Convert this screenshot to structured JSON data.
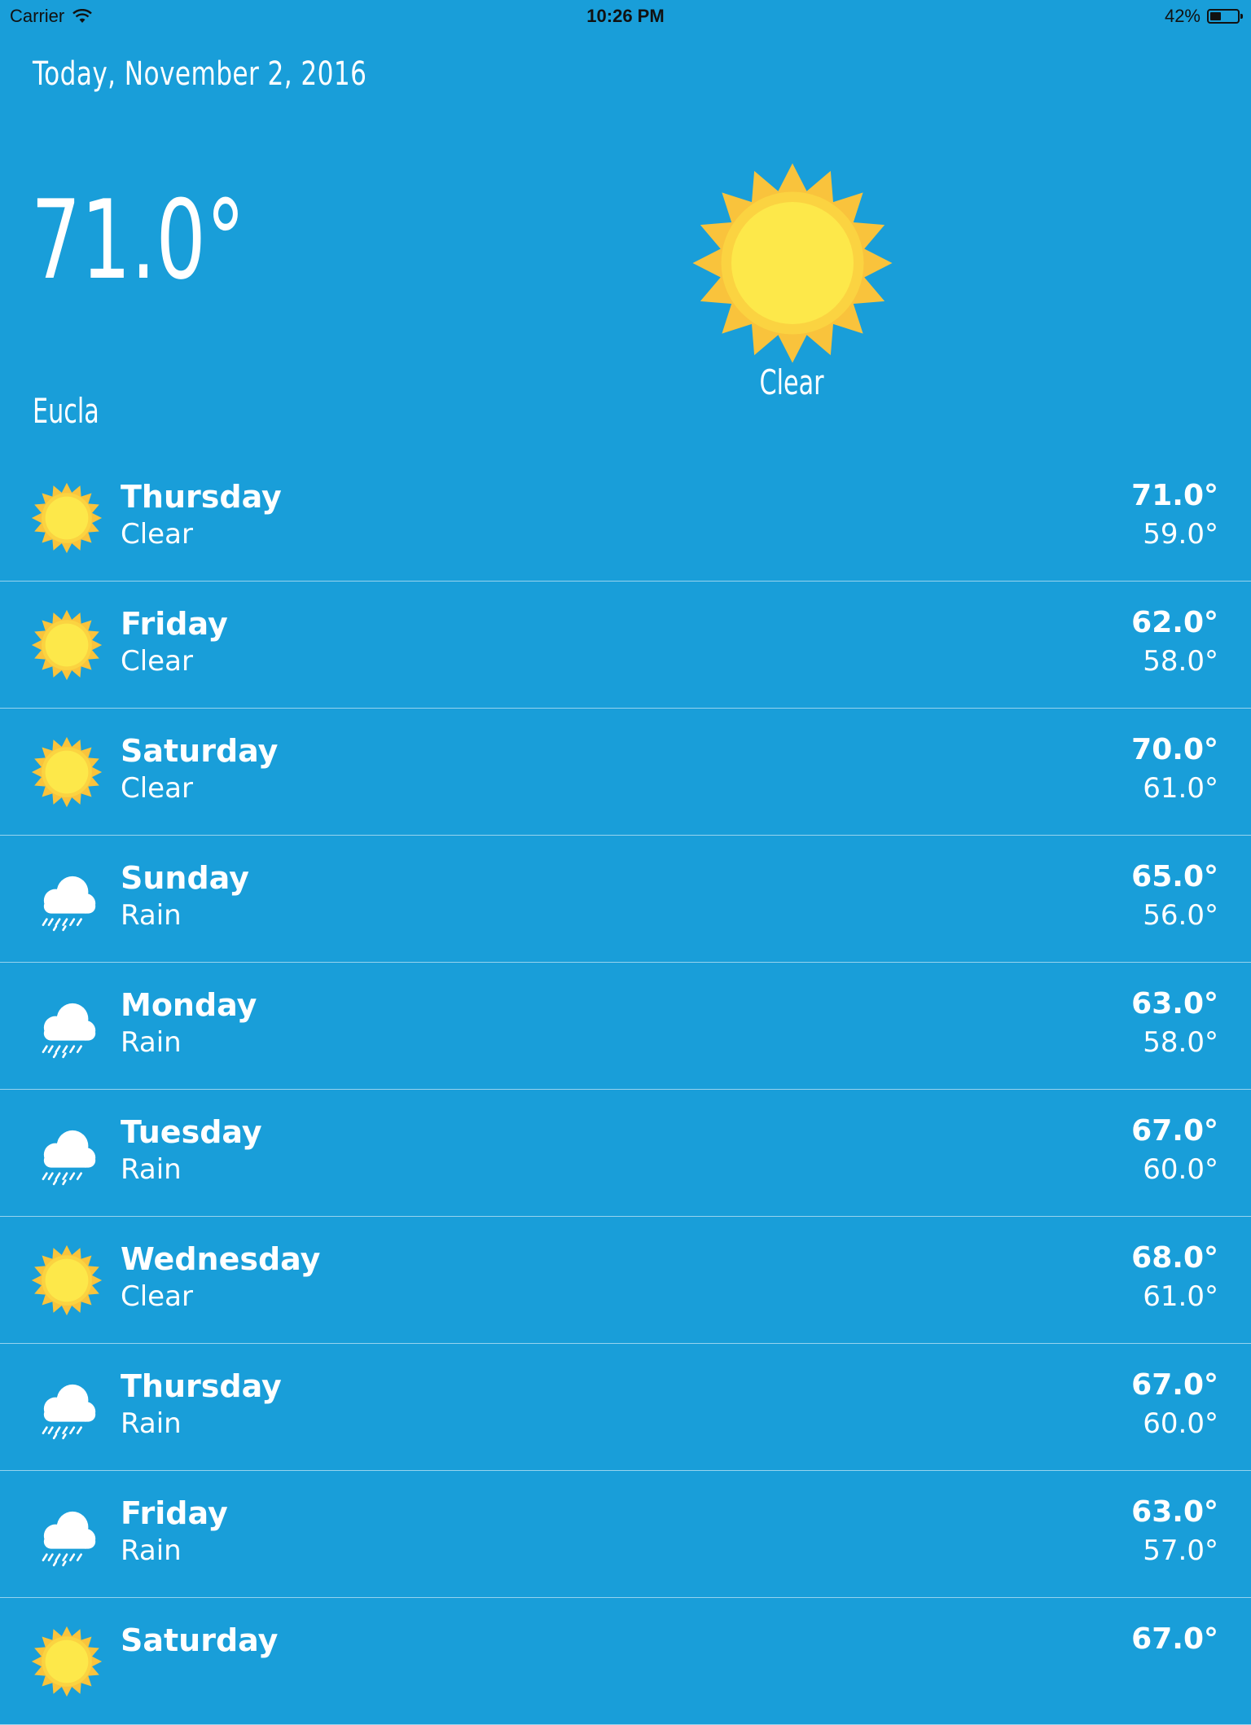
{
  "status_bar": {
    "carrier": "Carrier",
    "time": "10:26 PM",
    "battery": "42%",
    "battery_level": 0.42
  },
  "header": {
    "date": "Today, November 2, 2016",
    "current_temp": "71.0°",
    "location": "Eucla",
    "condition": "Clear",
    "condition_icon": "sun-icon"
  },
  "forecast": [
    {
      "day": "Thursday",
      "condition": "Clear",
      "icon": "sun-icon",
      "high": "71.0°",
      "low": "59.0°"
    },
    {
      "day": "Friday",
      "condition": "Clear",
      "icon": "sun-icon",
      "high": "62.0°",
      "low": "58.0°"
    },
    {
      "day": "Saturday",
      "condition": "Clear",
      "icon": "sun-icon",
      "high": "70.0°",
      "low": "61.0°"
    },
    {
      "day": "Sunday",
      "condition": "Rain",
      "icon": "rain-cloud-icon",
      "high": "65.0°",
      "low": "56.0°"
    },
    {
      "day": "Monday",
      "condition": "Rain",
      "icon": "rain-cloud-icon",
      "high": "63.0°",
      "low": "58.0°"
    },
    {
      "day": "Tuesday",
      "condition": "Rain",
      "icon": "rain-cloud-icon",
      "high": "67.0°",
      "low": "60.0°"
    },
    {
      "day": "Wednesday",
      "condition": "Clear",
      "icon": "sun-icon",
      "high": "68.0°",
      "low": "61.0°"
    },
    {
      "day": "Thursday",
      "condition": "Rain",
      "icon": "rain-cloud-icon",
      "high": "67.0°",
      "low": "60.0°"
    },
    {
      "day": "Friday",
      "condition": "Rain",
      "icon": "rain-cloud-icon",
      "high": "63.0°",
      "low": "57.0°"
    },
    {
      "day": "Saturday",
      "condition": "",
      "icon": "sun-icon",
      "high": "67.0°",
      "low": ""
    }
  ],
  "colors": {
    "background": "#199ed9",
    "sun_ray": "#f9c33c",
    "sun_core": "#fde84a",
    "text": "#ffffff"
  }
}
